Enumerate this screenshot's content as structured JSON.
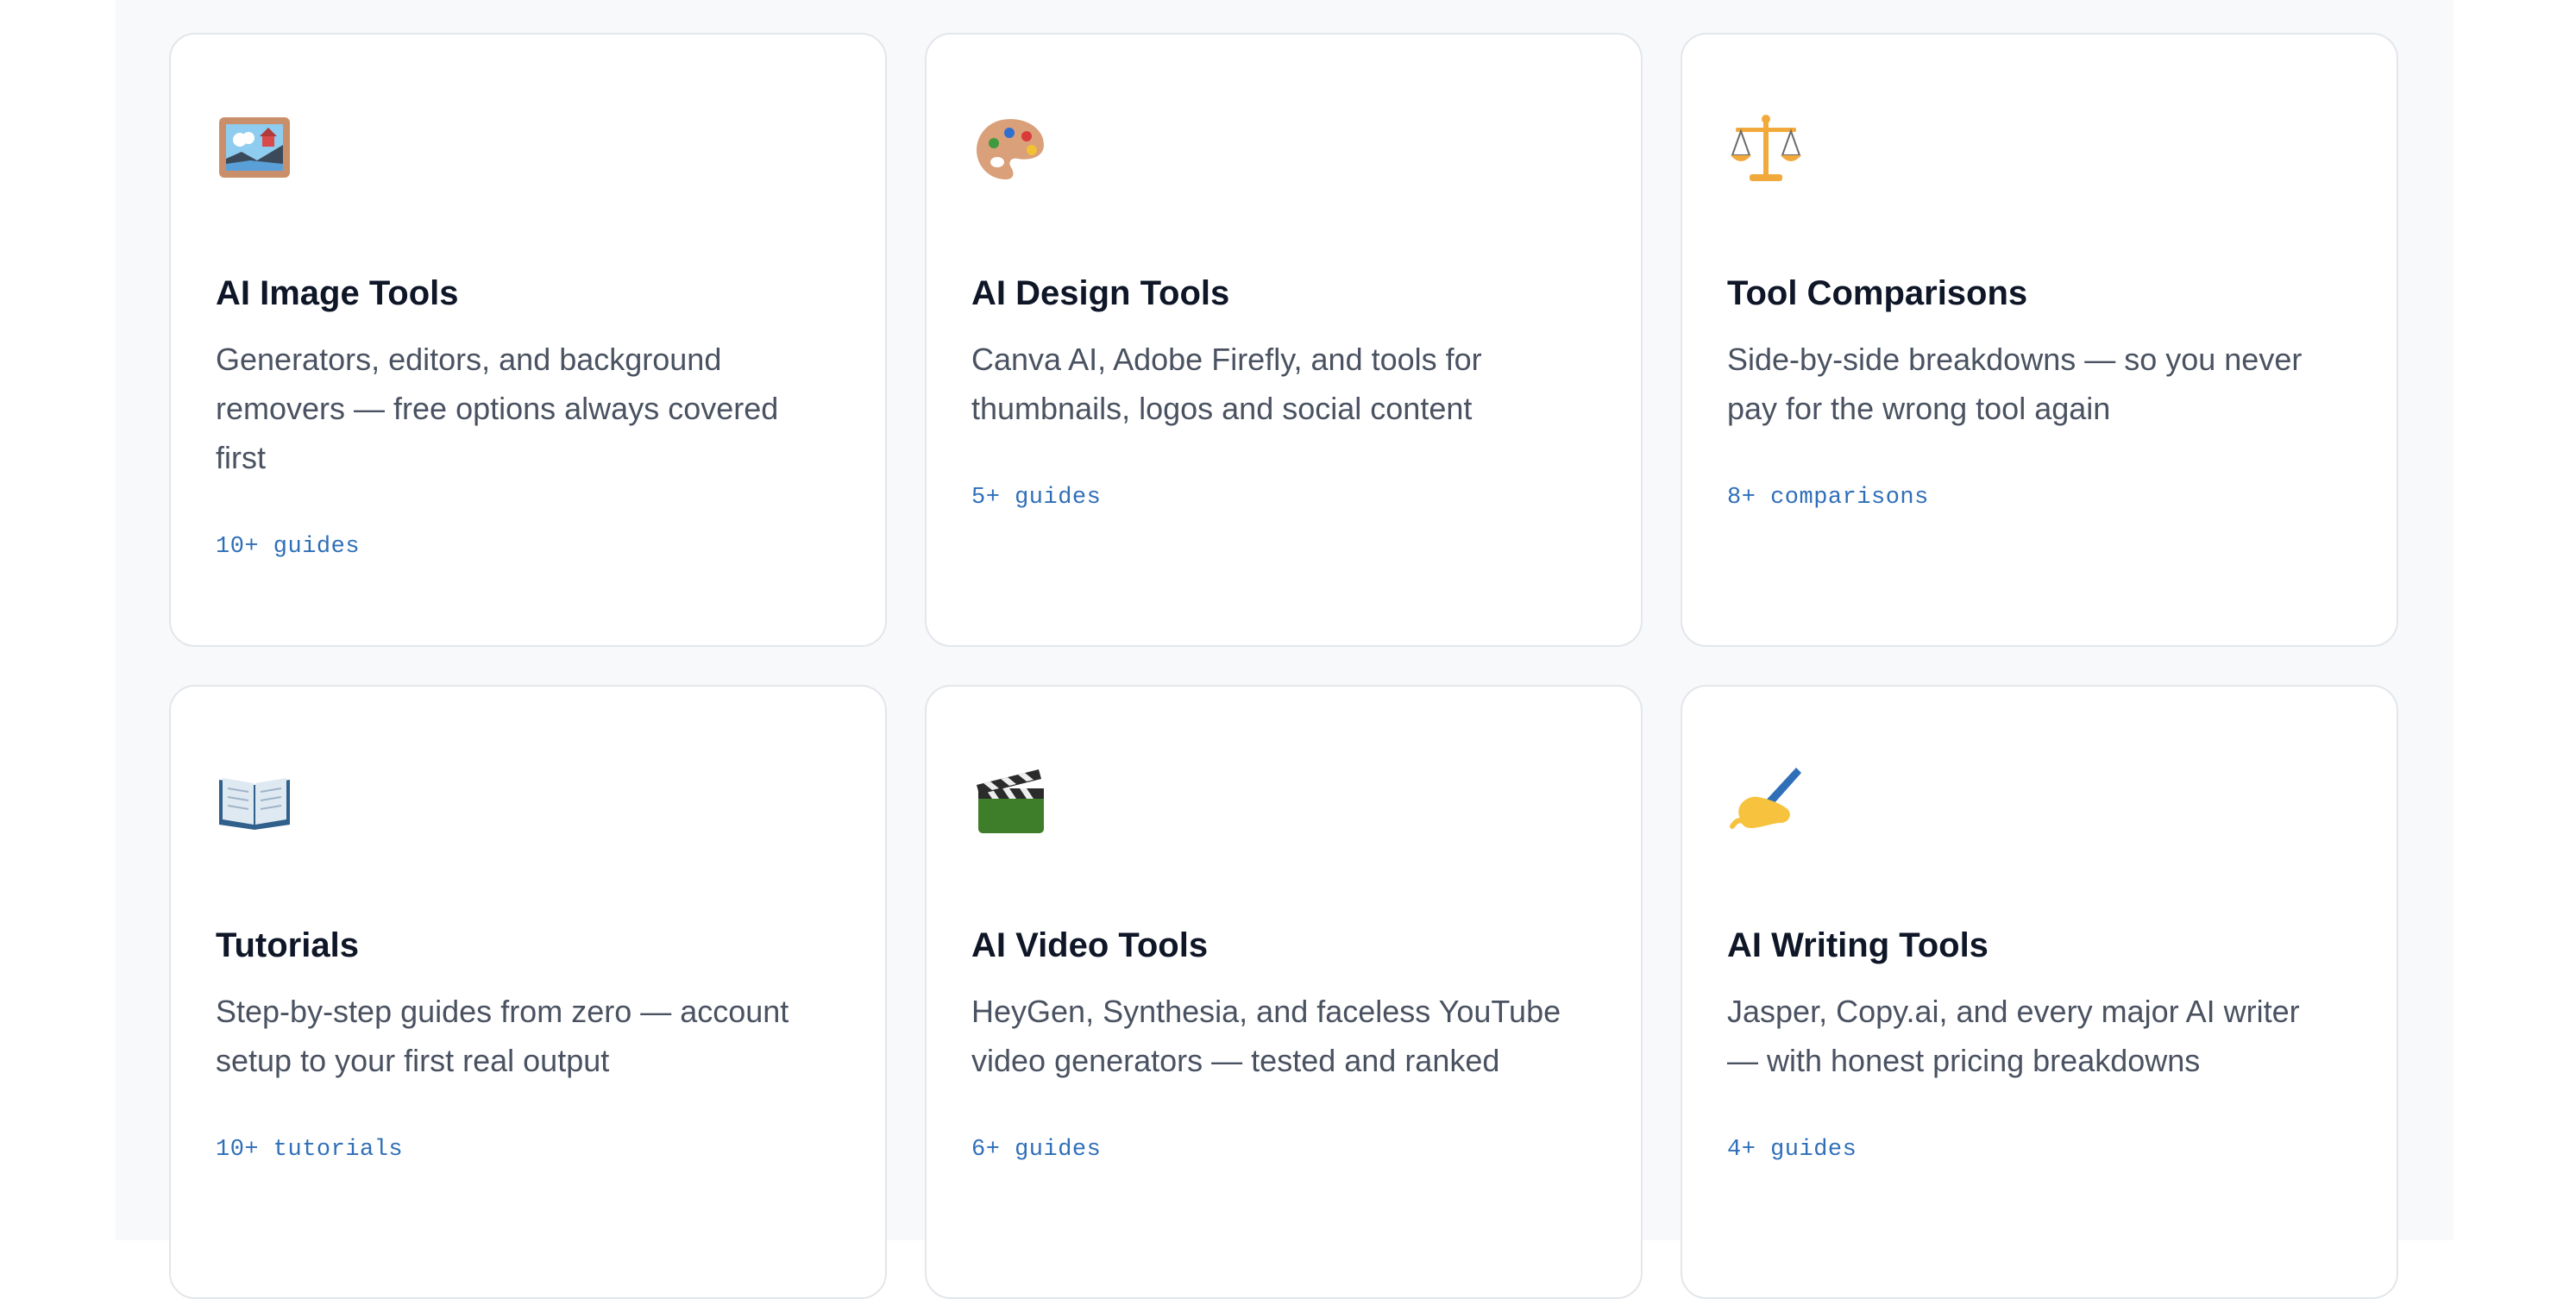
{
  "cards": [
    {
      "icon": "framed-picture-icon",
      "title": "AI Image Tools",
      "description": "Generators, editors, and background removers — free options always covered first",
      "count": "10+ guides"
    },
    {
      "icon": "artist-palette-icon",
      "title": "AI Design Tools",
      "description": "Canva AI, Adobe Firefly, and tools for thumbnails, logos and social content",
      "count": "5+ guides"
    },
    {
      "icon": "balance-scale-icon",
      "title": "Tool Comparisons",
      "description": "Side-by-side breakdowns — so you never pay for the wrong tool again",
      "count": "8+ comparisons"
    },
    {
      "icon": "open-book-icon",
      "title": "Tutorials",
      "description": "Step-by-step guides from zero — account setup to your first real output",
      "count": "10+ tutorials"
    },
    {
      "icon": "clapper-board-icon",
      "title": "AI Video Tools",
      "description": "HeyGen, Synthesia, and faceless YouTube video generators — tested and ranked",
      "count": "6+ guides"
    },
    {
      "icon": "writing-hand-icon",
      "title": "AI Writing Tools",
      "description": "Jasper, Copy.ai, and every major AI writer — with honest pricing breakdowns",
      "count": "4+ guides"
    }
  ],
  "colors": {
    "title": "#0e1627",
    "description": "#4a5261",
    "count": "#2f6fb8",
    "card_border": "#e3e6ea",
    "page_bg": "#f8f9fb"
  }
}
